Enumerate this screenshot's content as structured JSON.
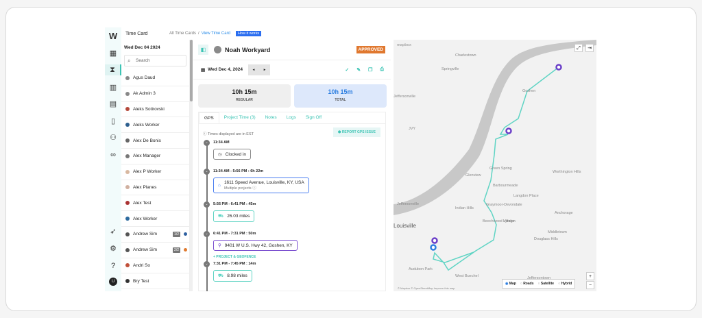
{
  "header": {
    "title": "Time Card",
    "crumb_all": "All Time Cards",
    "crumb_sep": "/",
    "crumb_current": "View Time Card",
    "how_it_works": "How it works"
  },
  "rail": {
    "logo": "W"
  },
  "list": {
    "date": "Wed Dec 04 2024",
    "search_placeholder": "Search",
    "employees": [
      {
        "name": "Agus Daud",
        "color": "#888"
      },
      {
        "name": "Ak Admin 3",
        "color": "#888"
      },
      {
        "name": "Aleks Sotirovski",
        "color": "#b4483a"
      },
      {
        "name": "Aleks Worker",
        "color": "#2d5f8e"
      },
      {
        "name": "Alex De Bonis",
        "color": "#666"
      },
      {
        "name": "Alex Manager",
        "color": "#777"
      },
      {
        "name": "Alex P Worker",
        "color": "#d8b8a0"
      },
      {
        "name": "Alex Planes",
        "color": "#d0b0a0"
      },
      {
        "name": "Alex Test",
        "color": "#a33"
      },
      {
        "name": "Alex Worker",
        "color": "#2d6a9e"
      },
      {
        "name": "Andrew Sim",
        "color": "#555",
        "badge": "1/2",
        "status": "#2d5fa0"
      },
      {
        "name": "Andrew Sim",
        "color": "#555",
        "badge": "2/2",
        "status": "#e07a2f"
      },
      {
        "name": "Andri So",
        "color": "#c0503a"
      },
      {
        "name": "Bry Test",
        "color": "#333"
      }
    ]
  },
  "detail": {
    "name": "Noah Workyard",
    "status": "APPROVED",
    "date": "Wed Dec 4, 2024",
    "prev": "◂",
    "next": "▸",
    "regular_value": "10h 15m",
    "regular_label": "REGULAR",
    "total_value": "10h 15m",
    "total_label": "TOTAL",
    "tabs": [
      "GPS",
      "Project Time (3)",
      "Notes",
      "Logs",
      "Sign Off"
    ],
    "timezone_note": "Times displayed are in EST",
    "report_button": "REPORT GPS ISSUE",
    "events": [
      {
        "time": "11:34 AM",
        "text": "Clocked in"
      },
      {
        "time": "11:34 AM - 5:56 PM : 6h 22m",
        "text": "1611 Speed Avenue, Louisville, KY, USA",
        "sub": "Multiple projects ⓘ"
      },
      {
        "time": "5:56 PM - 6:41 PM : 45m",
        "text": "26.03 miles"
      },
      {
        "time": "6:41 PM - 7:31 PM : 50m",
        "text": "9401 W U.S. Hwy 42, Goshen, KY",
        "add": "+ PROJECT & GEOFENCE"
      },
      {
        "time": "7:31 PM - 7:45 PM : 14m",
        "text": "8.98 miles"
      }
    ]
  },
  "map": {
    "labels": [
      "Charlestown",
      "Springville",
      "Goshen",
      "Green Spring",
      "Glenview",
      "Worthington Hills",
      "Barbourmeade",
      "Langdon Place",
      "Indian Hills",
      "Graymoor-Devondale",
      "Anchorage",
      "Beechwood Village",
      "Lyndon",
      "Middletown",
      "Douglass Hills",
      "Louisville",
      "Jeffersonville",
      "Audubon Park",
      "West Buechel",
      "Jeffersontown",
      "JVY",
      "Jeffersonville"
    ],
    "logo": "mapbox",
    "attribution": "© Mapbox © OpenStreetMap Improve this map",
    "zoom_in": "+",
    "zoom_out": "−",
    "types": [
      "Map",
      "Roads",
      "Satellite",
      "Hybrid"
    ],
    "selected_type": "Map",
    "route_color": "#5fd4c4",
    "marker_color": "#6b3fc8"
  }
}
